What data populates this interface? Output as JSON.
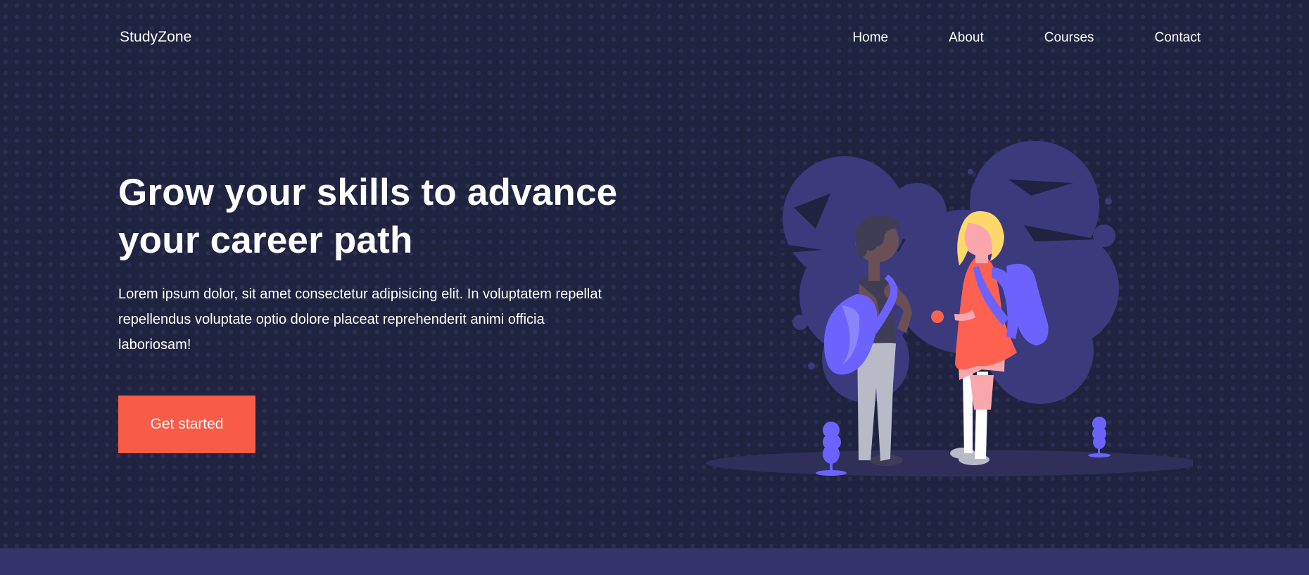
{
  "brand": {
    "name": "StudyZone"
  },
  "nav": {
    "items": [
      {
        "label": "Home"
      },
      {
        "label": "About"
      },
      {
        "label": "Courses"
      },
      {
        "label": "Contact"
      }
    ]
  },
  "hero": {
    "title": "Grow your skills to advance your career path",
    "description": "Lorem ipsum dolor, sit amet consectetur adipisicing elit. In voluptatem repellat repellendus voluptate optio dolore placeat reprehenderit animi officia laboriosam!",
    "cta_label": "Get started"
  },
  "colors": {
    "background": "#1f2340",
    "accent": "#f85b47",
    "illustration_blob": "#3b3a7d",
    "backpack": "#6c63ff",
    "footer_strip": "#34336a"
  }
}
